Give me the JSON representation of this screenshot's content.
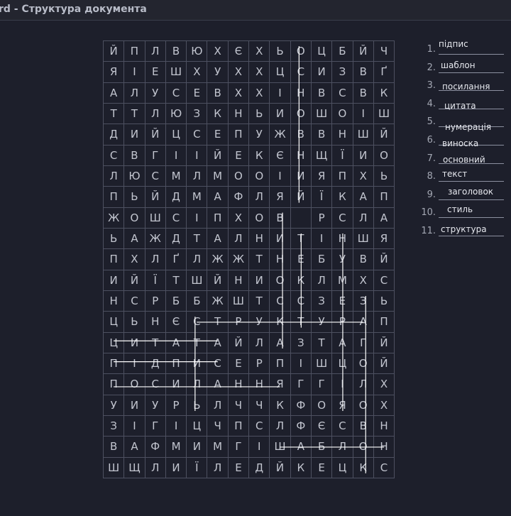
{
  "window": {
    "title": "rd - Структура документа"
  },
  "grid": {
    "rows": [
      [
        "Й",
        "П",
        "Л",
        "В",
        "Ю",
        "Х",
        "Є",
        "Х",
        "Ь",
        "О",
        "Ц",
        "Б",
        "Й",
        "Ч"
      ],
      [
        "Я",
        "І",
        "Е",
        "Ш",
        "Х",
        "У",
        "Х",
        "Х",
        "Ц",
        "С",
        "И",
        "З",
        "В",
        "Ґ"
      ],
      [
        "А",
        "Л",
        "У",
        "С",
        "Е",
        "В",
        "Х",
        "Х",
        "І",
        "Н",
        "В",
        "С",
        "В",
        "К"
      ],
      [
        "Т",
        "Т",
        "Л",
        "Ю",
        "З",
        "К",
        "Н",
        "Ь",
        "И",
        "О",
        "Ш",
        "О",
        "І",
        "Ш"
      ],
      [
        "Д",
        "И",
        "Й",
        "Ц",
        "С",
        "Е",
        "П",
        "У",
        "Ж",
        "В",
        "В",
        "Н",
        "Ш",
        "Й"
      ],
      [
        "С",
        "В",
        "Г",
        "І",
        "І",
        "Й",
        "Е",
        "К",
        "Є",
        "Н",
        "Щ",
        "Ї",
        "И",
        "О"
      ],
      [
        "Л",
        "Ю",
        "С",
        "М",
        "Л",
        "М",
        "О",
        "О",
        "І",
        "И",
        "Я",
        "П",
        "Х",
        "Ь"
      ],
      [
        "П",
        "Ь",
        "Й",
        "Д",
        "М",
        "А",
        "Ф",
        "Л",
        "Я",
        "Й",
        "Ї",
        "К",
        "А",
        "П"
      ],
      [
        "Ж",
        "О",
        "Ш",
        "С",
        "І",
        "П",
        "Х",
        "О",
        "В",
        "",
        "Р",
        "С",
        "Л",
        "А"
      ],
      [
        "Ь",
        "А",
        "Ж",
        "Д",
        "Т",
        "А",
        "Л",
        "Н",
        "И",
        "Т",
        "І",
        "Н",
        "Ш",
        "Я"
      ],
      [
        "П",
        "Х",
        "Л",
        "Ґ",
        "Л",
        "Ж",
        "Ж",
        "Т",
        "Н",
        "Е",
        "Б",
        "У",
        "В",
        "Й"
      ],
      [
        "И",
        "Й",
        "Ї",
        "Т",
        "Ш",
        "Й",
        "Н",
        "И",
        "О",
        "К",
        "Л",
        "М",
        "Х",
        "С"
      ],
      [
        "Н",
        "С",
        "Р",
        "Б",
        "Б",
        "Ж",
        "Ш",
        "Т",
        "С",
        "С",
        "З",
        "Е",
        "З",
        "Ь"
      ],
      [
        "Ц",
        "Ь",
        "Н",
        "Є",
        "С",
        "Т",
        "Р",
        "У",
        "К",
        "Т",
        "У",
        "Р",
        "А",
        "П"
      ],
      [
        "Ц",
        "И",
        "Т",
        "А",
        "Т",
        "А",
        "Й",
        "Л",
        "А",
        "З",
        "Т",
        "А",
        "Г",
        "Й"
      ],
      [
        "П",
        "І",
        "Д",
        "П",
        "И",
        "С",
        "Е",
        "Р",
        "П",
        "І",
        "Ш",
        "Ц",
        "О",
        "Й"
      ],
      [
        "П",
        "О",
        "С",
        "И",
        "Л",
        "А",
        "Н",
        "Н",
        "Я",
        "Г",
        "Г",
        "І",
        "Л",
        "Х"
      ],
      [
        "У",
        "И",
        "У",
        "Р",
        "Ь",
        "Л",
        "Ч",
        "Ч",
        "К",
        "Ф",
        "О",
        "Я",
        "О",
        "Х"
      ],
      [
        "З",
        "І",
        "Г",
        "І",
        "Ц",
        "Ч",
        "П",
        "С",
        "Л",
        "Ф",
        "Є",
        "С",
        "В",
        "Н"
      ],
      [
        "В",
        "А",
        "Ф",
        "М",
        "И",
        "М",
        "Г",
        "І",
        "Ш",
        "А",
        "Б",
        "Л",
        "О",
        "Н"
      ],
      [
        "Ш",
        "Щ",
        "Л",
        "И",
        "Ї",
        "Л",
        "Е",
        "Д",
        "Й",
        "К",
        "Е",
        "Ц",
        "К",
        "С"
      ]
    ]
  },
  "words": [
    {
      "num": "1.",
      "text": "підпис"
    },
    {
      "num": "2.",
      "text": "шаблон"
    },
    {
      "num": "3.",
      "text": "посилання"
    },
    {
      "num": "4.",
      "text": "цитата"
    },
    {
      "num": "5.",
      "text": "нумерація"
    },
    {
      "num": "6.",
      "text": "виноска"
    },
    {
      "num": "7.",
      "text": "основний"
    },
    {
      "num": "8.",
      "text": "текст"
    },
    {
      "num": "9.",
      "text": "заголовок"
    },
    {
      "num": "10.",
      "text": "стиль"
    },
    {
      "num": "11.",
      "text": "структура"
    }
  ],
  "found_lines": [
    {
      "word": "підпис",
      "from": [
        15,
        0
      ],
      "to": [
        15,
        5
      ]
    },
    {
      "word": "шаблон",
      "from": [
        19,
        8
      ],
      "to": [
        19,
        13
      ]
    },
    {
      "word": "посилання",
      "from": [
        16,
        0
      ],
      "to": [
        16,
        8
      ]
    },
    {
      "word": "цитата",
      "from": [
        14,
        0
      ],
      "to": [
        14,
        5
      ]
    },
    {
      "word": "нумерація",
      "from": [
        9,
        11
      ],
      "to": [
        17,
        11
      ]
    },
    {
      "word": "виноска",
      "from": [
        8,
        8
      ],
      "to": [
        14,
        8
      ]
    },
    {
      "word": "основний",
      "from": [
        0,
        9
      ],
      "to": [
        7,
        9
      ]
    },
    {
      "word": "текст",
      "from": [
        9,
        9
      ],
      "to": [
        13,
        9
      ]
    },
    {
      "word": "заголовок",
      "from": [
        12,
        12
      ],
      "to": [
        20,
        12
      ]
    },
    {
      "word": "стиль",
      "from": [
        13,
        4
      ],
      "to": [
        17,
        4
      ]
    },
    {
      "word": "структура",
      "from": [
        13,
        4
      ],
      "to": [
        13,
        12
      ]
    }
  ]
}
